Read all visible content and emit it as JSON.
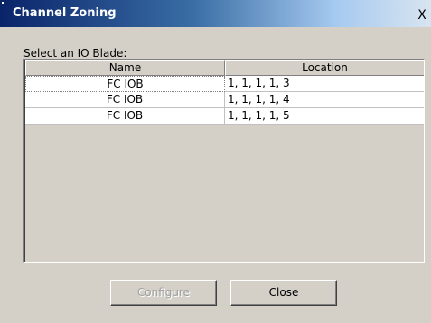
{
  "window": {
    "title": "Channel Zoning",
    "close_glyph": "X"
  },
  "prompt": "Select an IO Blade:",
  "table": {
    "columns": [
      "Name",
      "Location"
    ],
    "rows": [
      {
        "name": "FC IOB",
        "location": "1, 1, 1, 1, 3"
      },
      {
        "name": "FC IOB",
        "location": "1, 1, 1, 1, 4"
      },
      {
        "name": "FC IOB",
        "location": "1, 1, 1, 1, 5"
      }
    ],
    "selected_row": 0
  },
  "buttons": {
    "configure_label": "Configure",
    "configure_enabled": false,
    "close_label": "Close"
  },
  "colors": {
    "title_start": "#0a246a",
    "title_end": "#d8e4f0",
    "window_bg": "#d4d0c8"
  }
}
